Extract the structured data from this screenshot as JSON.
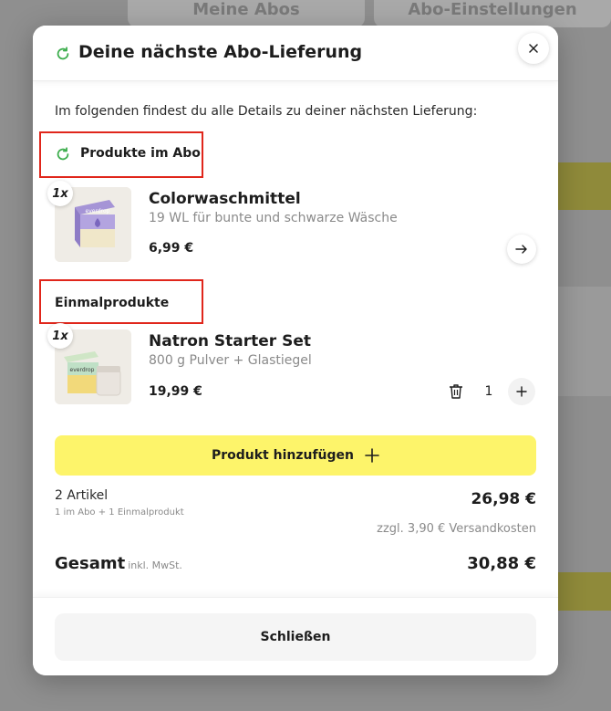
{
  "background": {
    "tab_left": "Meine Abos",
    "tab_right": "Abo-Einstellungen"
  },
  "modal": {
    "title": "Deine nächste Abo-Lieferung",
    "intro": "Im folgenden findest du alle Details zu deiner nächsten Lieferung:",
    "subscription_section": {
      "label": "Produkte im Abo",
      "product": {
        "quantity": "1x",
        "name": "Colorwaschmittel",
        "description": "19 WL für bunte und schwarze Wäsche",
        "price": "6,99 €",
        "image_brand": "everdrop"
      }
    },
    "one_time_section": {
      "label": "Einmalprodukte",
      "product": {
        "quantity": "1x",
        "name": "Natron Starter Set",
        "description": "800 g Pulver + Glastiegel",
        "price": "19,99 €",
        "stepper_value": "1",
        "image_brand": "everdrop"
      }
    },
    "add_button": "Produkt hinzufügen",
    "summary": {
      "count": "2 Artikel",
      "breakdown": "1 im Abo + 1 Einmalprodukt",
      "subtotal": "26,98 €",
      "shipping": "zzgl. 3,90 € Versandkosten",
      "total_label": "Gesamt",
      "total_tax_note": "inkl. MwSt.",
      "total": "30,88 €"
    },
    "close_button": "Schließen"
  },
  "colors": {
    "accent_green": "#3fae4f",
    "highlight_red": "#e0261b",
    "add_button_yellow": "#fdf46a"
  }
}
